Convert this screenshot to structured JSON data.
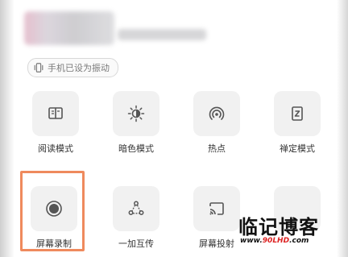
{
  "status": {
    "vibrate_text": "手机已设为振动"
  },
  "tiles": [
    {
      "label": "阅读模式",
      "icon": "book-icon"
    },
    {
      "label": "暗色模式",
      "icon": "dark-mode-icon"
    },
    {
      "label": "热点",
      "icon": "hotspot-icon"
    },
    {
      "label": "禅定模式",
      "icon": "zen-mode-icon"
    },
    {
      "label": "屏幕录制",
      "icon": "record-icon",
      "highlighted": true
    },
    {
      "label": "一加互传",
      "icon": "share-icon"
    },
    {
      "label": "屏幕投射",
      "icon": "cast-icon"
    }
  ],
  "watermark": {
    "title": "临记博客",
    "url_prefix": "www.",
    "url_site": "90LHD",
    "url_suffix": ".com"
  },
  "colors": {
    "highlight_border": "#ef8a5d",
    "tile_bg": "#f1f1f1",
    "icon": "#555555"
  }
}
